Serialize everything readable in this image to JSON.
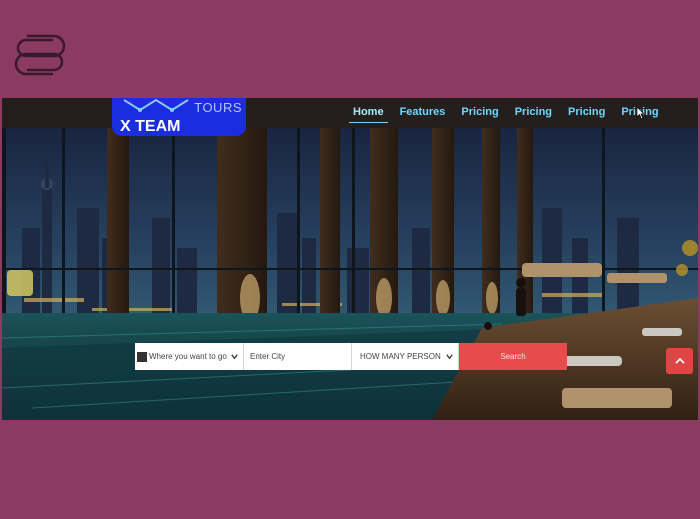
{
  "brand": {
    "title": "X TEAM",
    "subtitle": "TOURS"
  },
  "nav": {
    "items": [
      {
        "label": "Home",
        "active": true
      },
      {
        "label": "Features",
        "active": false
      },
      {
        "label": "Pricing",
        "active": false
      },
      {
        "label": "Pricing",
        "active": false
      },
      {
        "label": "Pricing",
        "active": false
      },
      {
        "label": "Pricing",
        "active": false
      }
    ]
  },
  "search": {
    "where_label": "Where you want to go",
    "city_placeholder": "Enter City",
    "person_label": "HOW MANY PERSON",
    "button_label": "Search"
  },
  "icons": {
    "logo": "paperclip-logo-icon",
    "back_to_top": "chevron-up-icon",
    "select_arrow": "chevron-down-icon"
  },
  "colors": {
    "page_bg": "#8b3a62",
    "brand_bg": "#1a2ee0",
    "nav_text": "#6fd6ff",
    "search_button": "#e84b4b"
  }
}
